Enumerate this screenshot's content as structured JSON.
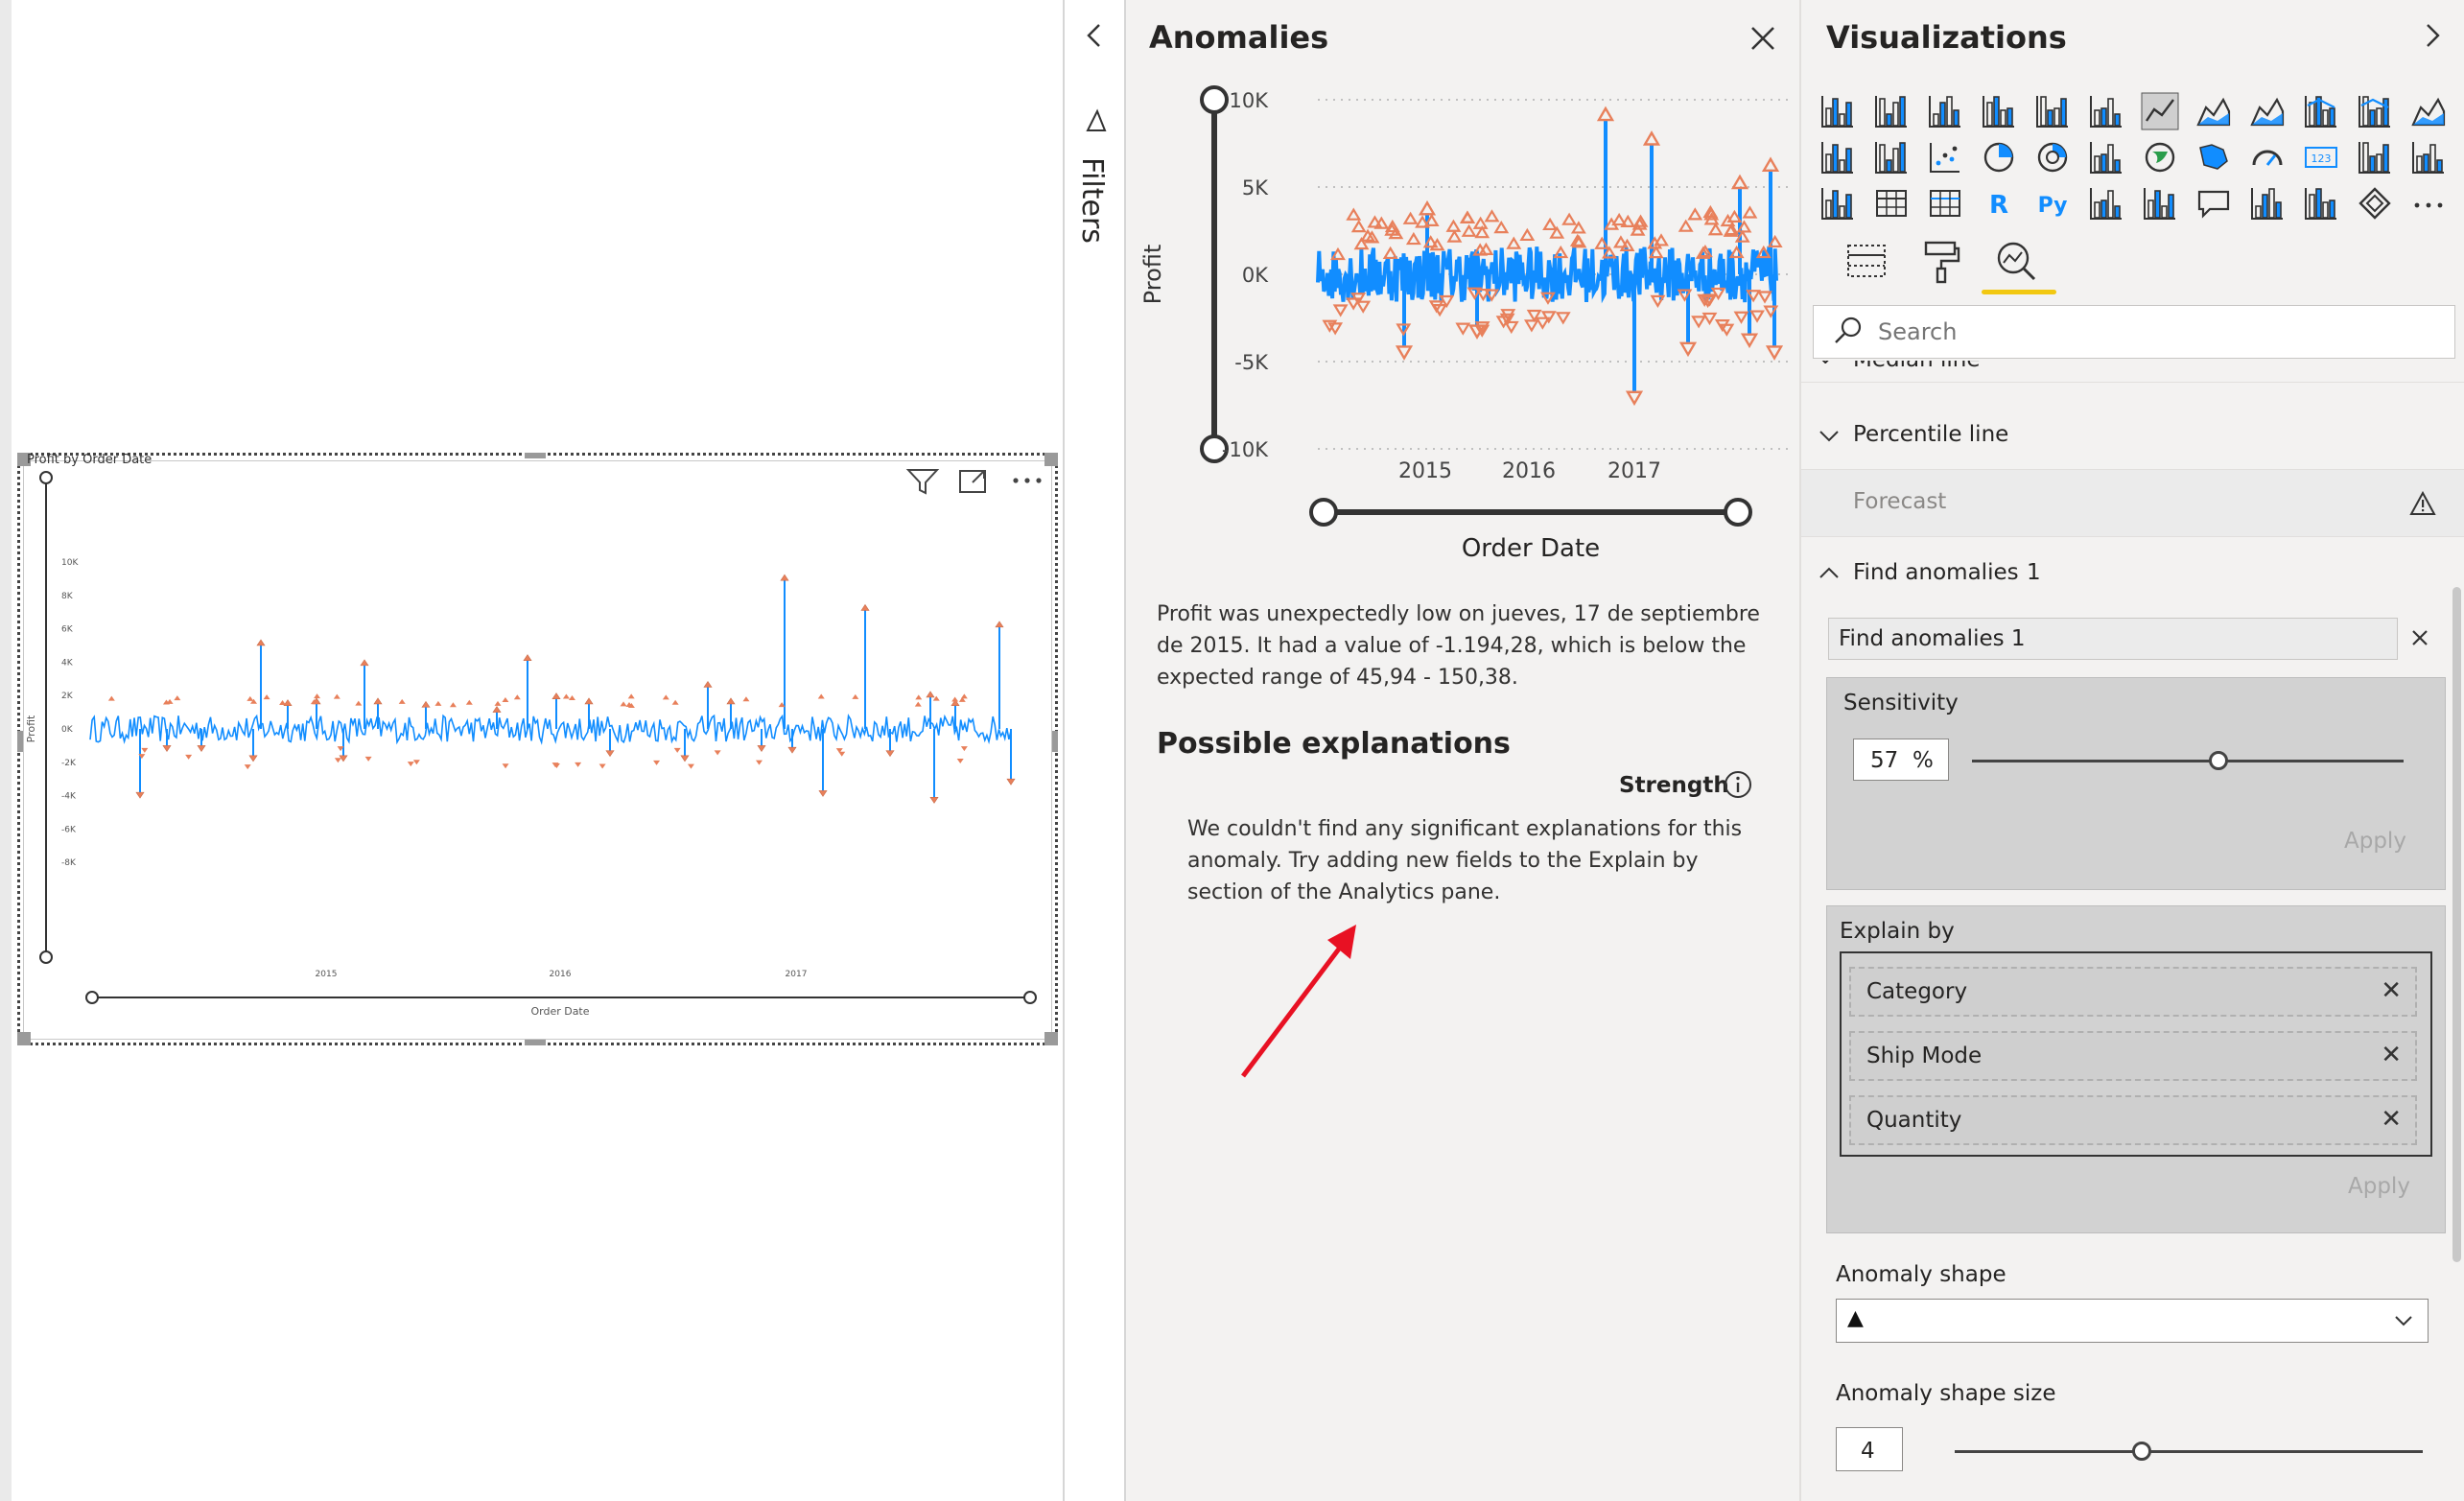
{
  "canvas": {
    "visual_title": "Profit by Order Date",
    "x_axis_title": "Order Date",
    "y_axis_title": "Profit",
    "y_ticks": [
      "10K",
      "8K",
      "6K",
      "4K",
      "2K",
      "0K",
      "-2K",
      "-4K",
      "-6K",
      "-8K"
    ],
    "x_ticks": [
      "2015",
      "2016",
      "2017"
    ],
    "toolbar": {
      "filter_icon": "filter-icon",
      "focus_icon": "focus-mode-icon",
      "more_icon": "more-options-icon"
    }
  },
  "filters": {
    "label": "Filters"
  },
  "anomalies": {
    "title": "Anomalies",
    "chart": {
      "y_axis_title": "Profit",
      "x_axis_title": "Order Date",
      "y_ticks": [
        "10K",
        "5K",
        "0K",
        "-5K",
        "-10K"
      ],
      "x_ticks": [
        "2015",
        "2016",
        "2017"
      ]
    },
    "description": "Profit was unexpectedly low on jueves, 17 de septiembre de 2015. It had a value of -1.194,28, which is below the expected range of 45,94 - 150,38.",
    "explanations_heading": "Possible explanations",
    "strength_label": "Strength",
    "no_explanations": "We couldn't find any significant explanations for this anomaly. Try adding new fields to the Explain by section of the Analytics pane."
  },
  "visualizations": {
    "title": "Visualizations",
    "search_placeholder": "Search",
    "sections": {
      "median": "Median line",
      "percentile": "Percentile line",
      "forecast": "Forecast",
      "find_anomalies": "Find anomalies",
      "find_anomalies_count": "1"
    },
    "anomaly_item_name": "Find anomalies 1",
    "sensitivity_label": "Sensitivity",
    "sensitivity_value": "57",
    "sensitivity_unit": "%",
    "sensitivity_level": 0.57,
    "apply_label": "Apply",
    "explain_by_label": "Explain by",
    "explain_by_fields": [
      "Category",
      "Ship Mode",
      "Quantity"
    ],
    "anomaly_shape_label": "Anomaly shape",
    "anomaly_shape_value": "▲",
    "anomaly_shape_size_label": "Anomaly shape size",
    "anomaly_shape_size_value": "4",
    "anomaly_shape_size_level": 0.4
  },
  "colors": {
    "series": "#118DFF",
    "anomaly": "#E8805B",
    "accent_underline": "#F2C811",
    "arrow": "#E81123"
  }
}
